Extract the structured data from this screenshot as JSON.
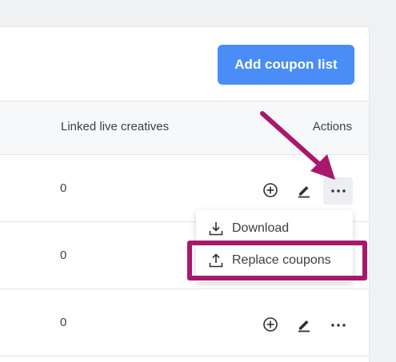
{
  "toolbar": {
    "add_button_label": "Add coupon list"
  },
  "table": {
    "columns": [
      "Linked live creatives",
      "Actions"
    ],
    "rows": [
      {
        "linked_live_creatives": "0"
      },
      {
        "linked_live_creatives": "0"
      },
      {
        "linked_live_creatives": "0"
      }
    ]
  },
  "actions_menu": {
    "items": [
      {
        "label": "Download",
        "icon": "download-icon"
      },
      {
        "label": "Replace coupons",
        "icon": "upload-icon"
      }
    ]
  },
  "icons": {
    "row_actions": [
      "plus-circle-icon",
      "pencil-icon",
      "more-horizontal-icon"
    ]
  },
  "colors": {
    "primary_button": "#4a8df6",
    "annotation": "#a8186d"
  }
}
